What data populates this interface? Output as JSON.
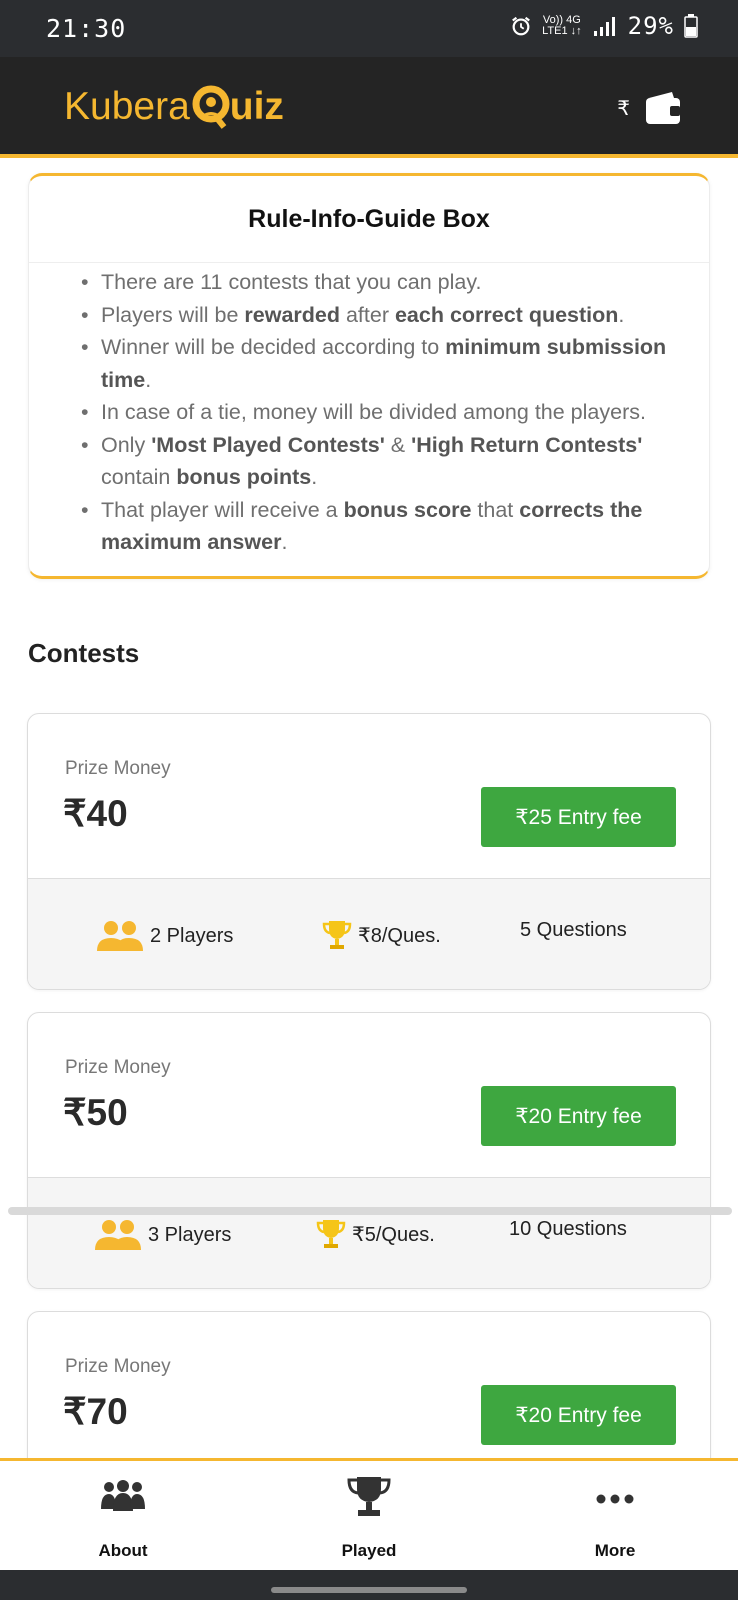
{
  "status_bar": {
    "time": "21:30",
    "network_top": "Vo)) 4G",
    "network_bottom": "LTE1 ↓↑",
    "battery": "29%"
  },
  "header": {
    "logo_left": "Kubera",
    "logo_right": "uiz",
    "currency": "₹",
    "brand_color": "#f5b730"
  },
  "rules": {
    "title": "Rule-Info-Guide Box",
    "items": [
      {
        "parts": [
          {
            "t": "There are 11 contests that you can play."
          }
        ]
      },
      {
        "parts": [
          {
            "t": "Players will be "
          },
          {
            "t": "rewarded",
            "b": true
          },
          {
            "t": " after "
          },
          {
            "t": "each correct question",
            "b": true
          },
          {
            "t": "."
          }
        ]
      },
      {
        "parts": [
          {
            "t": "Winner will be decided according to "
          },
          {
            "t": "minimum submission time",
            "b": true
          },
          {
            "t": "."
          }
        ]
      },
      {
        "parts": [
          {
            "t": "In case of a tie, money will be divided among the players."
          }
        ]
      },
      {
        "parts": [
          {
            "t": "Only "
          },
          {
            "t": "'Most Played Contests'",
            "b": true
          },
          {
            "t": " & "
          },
          {
            "t": "'High Return Contests'",
            "b": true
          },
          {
            "t": " contain "
          },
          {
            "t": "bonus points",
            "b": true
          },
          {
            "t": "."
          }
        ]
      },
      {
        "parts": [
          {
            "t": "That player will receive a "
          },
          {
            "t": "bonus score",
            "b": true
          },
          {
            "t": " that "
          },
          {
            "t": "corrects the maximum answer",
            "b": true
          },
          {
            "t": "."
          }
        ]
      }
    ]
  },
  "contests_title": "Contests",
  "contests": [
    {
      "prize_label": "Prize Money",
      "prize": "₹40",
      "entry": "₹25 Entry fee",
      "players": "2 Players",
      "per_question": "₹8/Ques.",
      "questions": "5 Questions"
    },
    {
      "prize_label": "Prize Money",
      "prize": "₹50",
      "entry": "₹20 Entry fee",
      "players": "3 Players",
      "per_question": "₹5/Ques.",
      "questions": "10 Questions"
    },
    {
      "prize_label": "Prize Money",
      "prize": "₹70",
      "entry": "₹20 Entry fee"
    }
  ],
  "bottom_nav": [
    {
      "label": "About",
      "icon": "group-icon"
    },
    {
      "label": "Played",
      "icon": "trophy-icon"
    },
    {
      "label": "More",
      "icon": "more-icon"
    }
  ]
}
